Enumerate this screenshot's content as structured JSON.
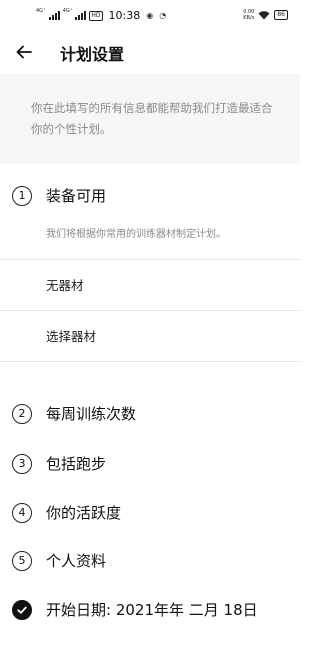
{
  "status_bar": {
    "signal_1": "4G⁺",
    "signal_2": "4G⁺",
    "hd": "HD",
    "time": "10:38",
    "net_speed_value": "0.00",
    "net_speed_unit": "KB/s",
    "battery": "86"
  },
  "header": {
    "title": "计划设置"
  },
  "intro": "你在此填写的所有信息都能帮助我们打造最适合你的个性计划。",
  "equipment": {
    "number": "1",
    "title": "装备可用",
    "description": "我们将根据你常用的训练器材制定计划。",
    "options": [
      "无器材",
      "选择器材"
    ]
  },
  "steps": [
    {
      "number": "2",
      "label": "每周训练次数"
    },
    {
      "number": "3",
      "label": "包括跑步"
    },
    {
      "number": "4",
      "label": "你的活跃度"
    },
    {
      "number": "5",
      "label": "个人资料"
    }
  ],
  "start_date": {
    "label": "开始日期: 2021年年 二月 18日",
    "done": true
  }
}
